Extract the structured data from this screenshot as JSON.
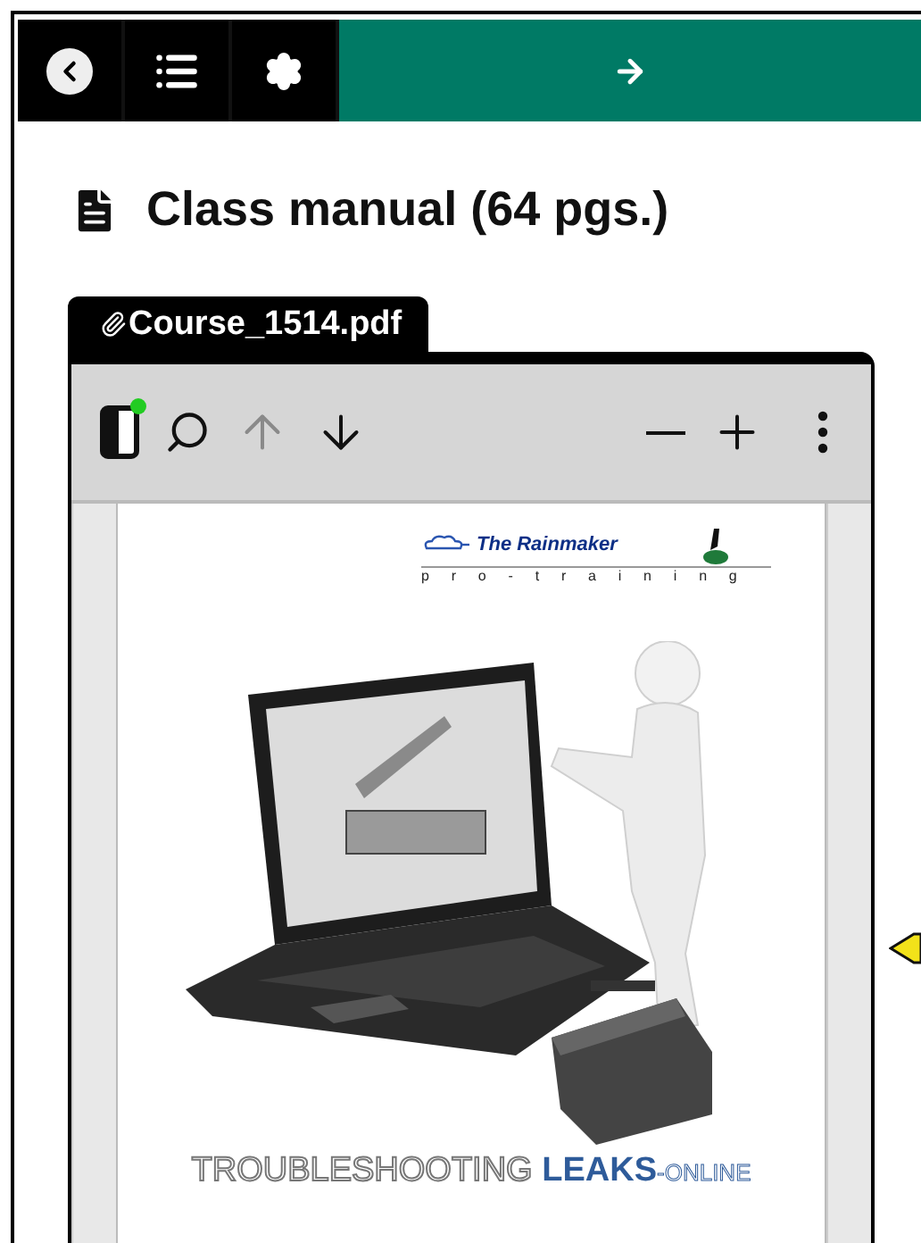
{
  "toolbar": {
    "buttons": [
      {
        "kind": "back"
      },
      {
        "kind": "contents"
      },
      {
        "kind": "settings"
      }
    ],
    "next": {
      "kind": "next"
    }
  },
  "heading": {
    "title": "Class manual (64 pgs.)"
  },
  "attachment": {
    "filename": "Course_1514.pdf"
  },
  "viewer": {
    "sidebar_toggle": {
      "badge": true
    },
    "tools": [
      {
        "kind": "search",
        "disabled": false
      },
      {
        "kind": "previous",
        "disabled": true
      },
      {
        "kind": "next",
        "disabled": false
      },
      {
        "kind": "zoom-out",
        "disabled": false
      },
      {
        "kind": "zoom-in",
        "disabled": false
      },
      {
        "kind": "more",
        "disabled": false
      }
    ],
    "page": {
      "logo_name": "The Rainmaker",
      "logo_tagline": "pro-training",
      "title_lead": "TROUBLESHOOTING",
      "title_accent": "LEAKS",
      "title_tail": "-ONLINE"
    }
  }
}
